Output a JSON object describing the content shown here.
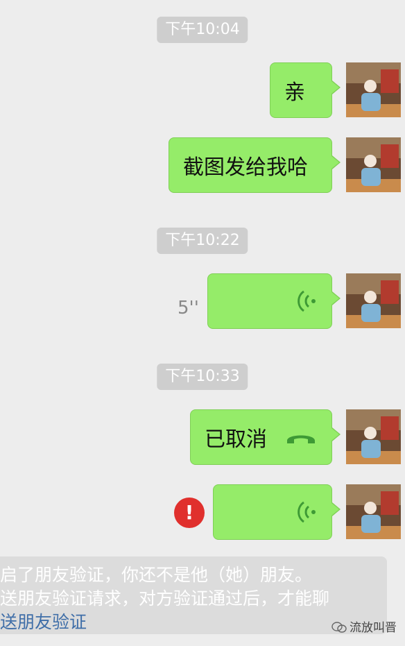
{
  "messages": {
    "ts1": "下午10:04",
    "msg1": "亲",
    "msg2": "截图发给我哈",
    "ts2": "下午10:22",
    "voice_duration": "5''",
    "ts3": "下午10:33",
    "cancelled": "已取消",
    "error_mark": "!"
  },
  "notice": {
    "line1": "启了朋友验证，你还不是他（她）朋友。",
    "line2": "送朋友验证请求，对方验证通过后，才能聊",
    "link": "送朋友验证"
  },
  "watermark": "流放叫晋",
  "colors": {
    "bubble": "#95ec69",
    "bg": "#ededed",
    "error": "#e0302d",
    "link": "#3f6ea8"
  }
}
